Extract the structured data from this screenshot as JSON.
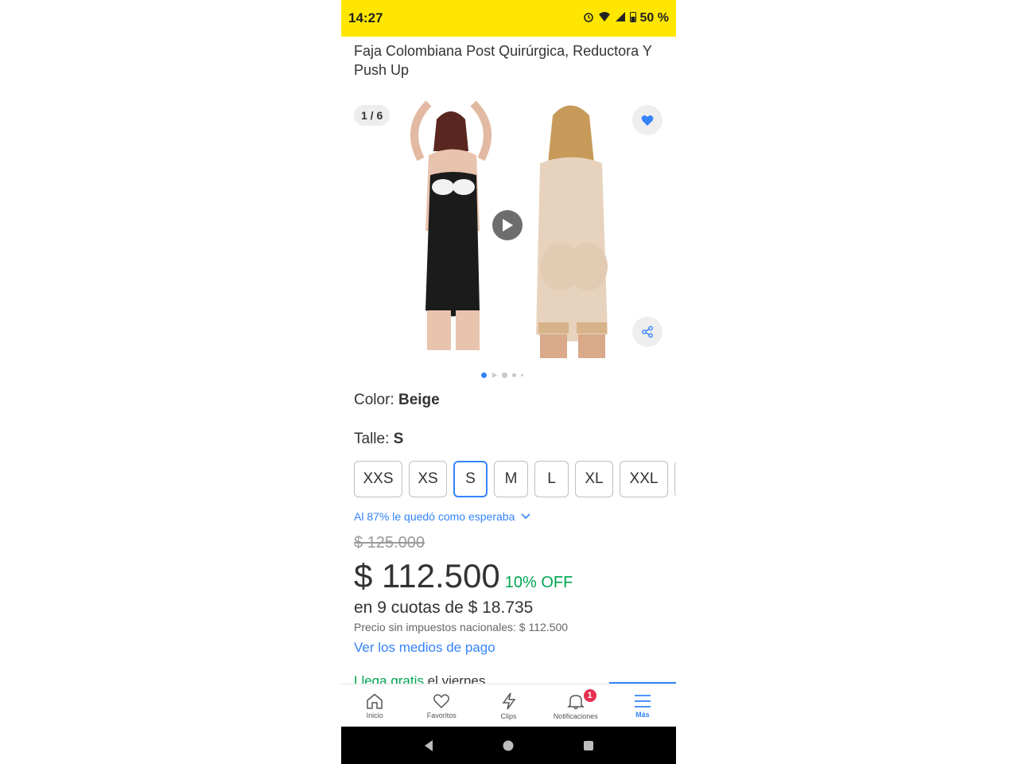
{
  "status_bar": {
    "time": "14:27",
    "battery": "50 %"
  },
  "product": {
    "title": "Faja Colombiana Post Quirúrgica, Reductora Y Push Up",
    "image_counter": "1 / 6",
    "color_label": "Color: ",
    "color_value": "Beige",
    "size_label": "Talle: ",
    "size_value": "S",
    "sizes": [
      "XXS",
      "XS",
      "S",
      "M",
      "L",
      "XL",
      "XXL"
    ],
    "selected_size": "S",
    "rating_text": "Al 87% le quedó como esperaba",
    "original_price": "$ 125.000",
    "price": "$ 112.500",
    "discount": "10% OFF",
    "installments_prefix": "en 9 cuotas de ",
    "installments_amount": "$ 18.735",
    "tax_text": "Precio sin impuestos nacionales: $ 112.500",
    "payment_link": "Ver los medios de pago",
    "shipping_green": "Llega gratis",
    "shipping_rest": " el viernes"
  },
  "bottom_nav": {
    "items": [
      {
        "label": "Inicio",
        "icon": "home-icon"
      },
      {
        "label": "Favoritos",
        "icon": "heart-icon"
      },
      {
        "label": "Clips",
        "icon": "bolt-icon"
      },
      {
        "label": "Notificaciones",
        "icon": "bell-icon",
        "badge": "1"
      },
      {
        "label": "Más",
        "icon": "menu-icon",
        "active": true
      }
    ]
  },
  "colors": {
    "accent": "#3483fa",
    "brand_yellow": "#ffe600",
    "discount_green": "#00a650",
    "badge_red": "#e62f4f"
  }
}
